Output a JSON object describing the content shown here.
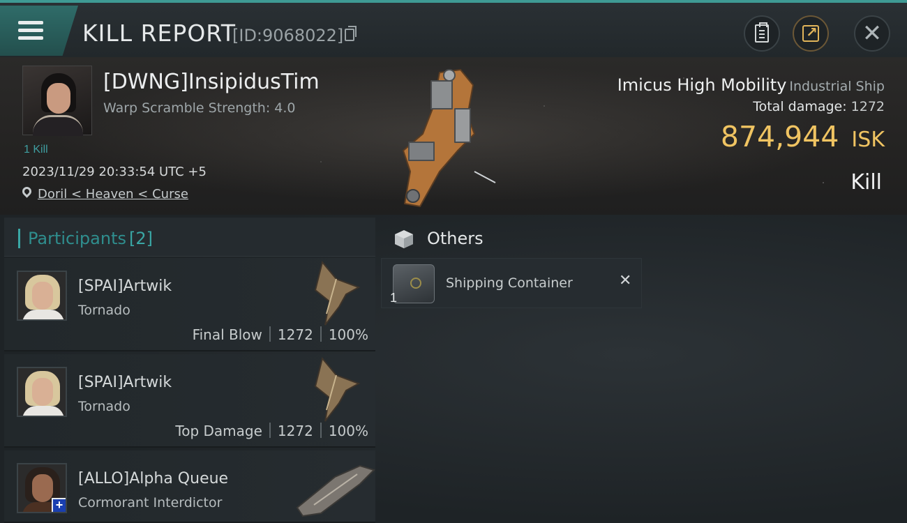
{
  "header": {
    "title": "KILL REPORT",
    "report_id": "[ID:9068022]"
  },
  "victim": {
    "name": "[DWNG]InsipidusTim",
    "warp_scramble": "Warp Scramble Strength: 4.0",
    "kills": "1 Kill",
    "datetime": "2023/11/29 20:33:54 UTC +5",
    "location": "Doril < Heaven < Curse",
    "ship_name": "Imicus High Mobility",
    "ship_class": "Industrial Ship",
    "total_damage_label": "Total damage:",
    "total_damage": "1272",
    "isk_value": "874,944",
    "isk_unit": "ISK",
    "result": "Kill"
  },
  "participants": {
    "label": "Participants",
    "count": "[2]",
    "items": [
      {
        "name": "[SPAI]Artwik",
        "ship": "Tornado",
        "role": "Final Blow",
        "damage": "1272",
        "percent": "100%"
      },
      {
        "name": "[SPAI]Artwik",
        "ship": "Tornado",
        "role": "Top Damage",
        "damage": "1272",
        "percent": "100%"
      },
      {
        "name": "[ALLO]Alpha Queue",
        "ship": "Cormorant Interdictor"
      }
    ]
  },
  "others": {
    "label": "Others",
    "items": [
      {
        "name": "Shipping Container",
        "quantity": "1",
        "status_glyph": "✕"
      }
    ]
  },
  "colors": {
    "accent": "#3aa7a5",
    "isk": "#f0c462",
    "background": "#1b1f22"
  },
  "icons": {
    "menu": "menu-icon",
    "copy": "copy-icon",
    "clipboard": "clipboard-icon",
    "share": "share-icon",
    "close": "close-icon",
    "location": "map-pin-icon",
    "others": "cube-icon"
  }
}
